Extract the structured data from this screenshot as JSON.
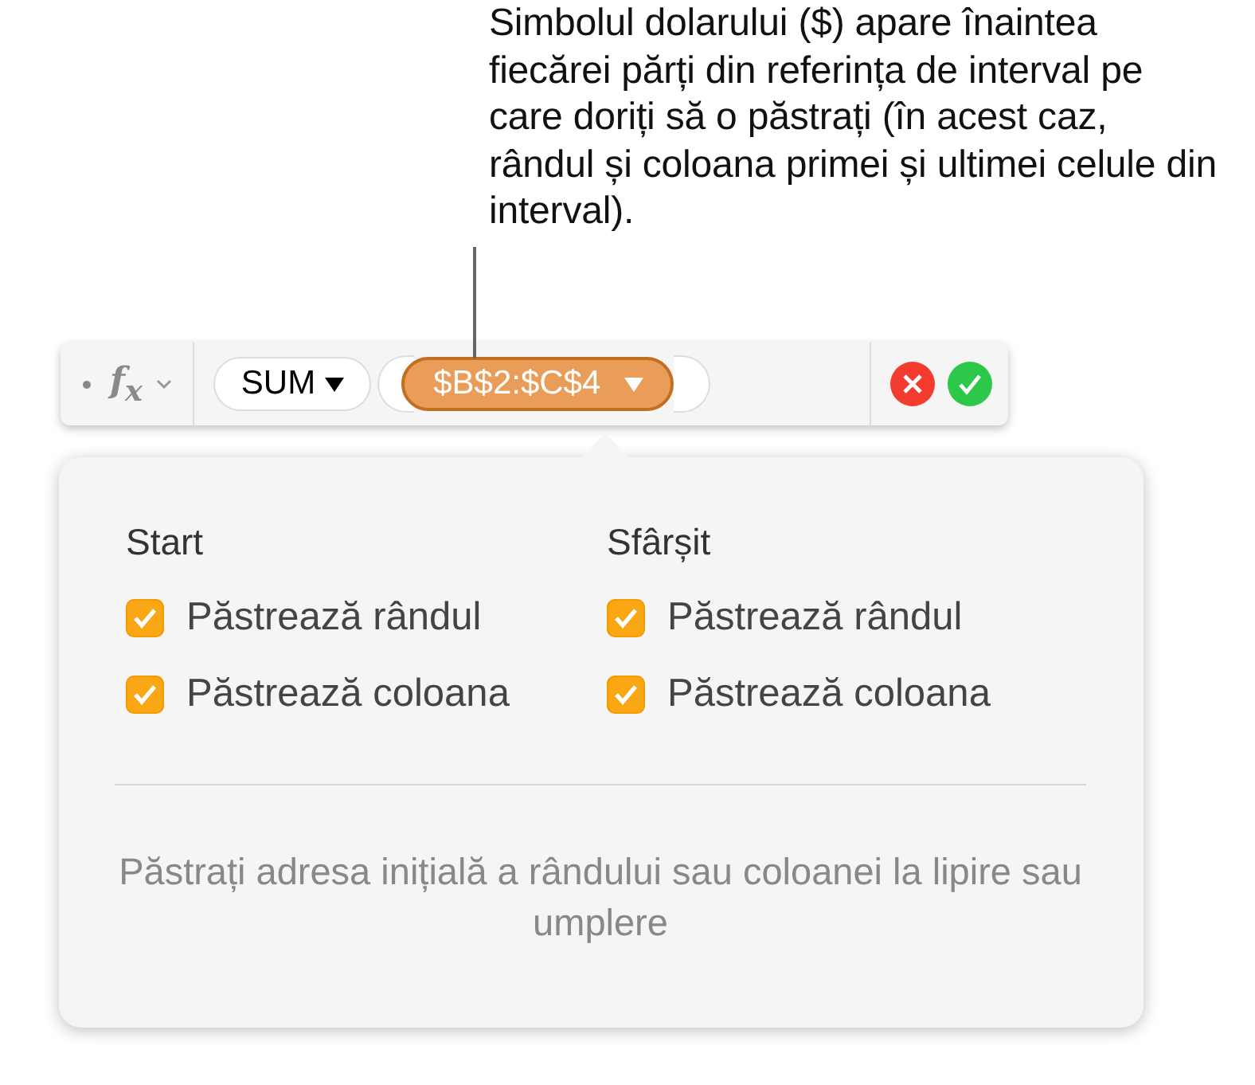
{
  "callout": {
    "text": "Simbolul dolarului ($) apare înaintea fiecărei părți din referința de interval pe care doriți să o păstrați (în acest caz, rândul și coloana primei și ultimei celule din interval)."
  },
  "formula_bar": {
    "fx": "f$_{x}$",
    "function": "SUM",
    "reference": "$B$2:$C$4"
  },
  "popover": {
    "columns": [
      {
        "title": "Start",
        "options": [
          {
            "label": "Păstrează rândul",
            "checked": true
          },
          {
            "label": "Păstrează coloana",
            "checked": true
          }
        ]
      },
      {
        "title": "Sfârșit",
        "options": [
          {
            "label": "Păstrează rândul",
            "checked": true
          },
          {
            "label": "Păstrează coloana",
            "checked": true
          }
        ]
      }
    ],
    "footer": "Păstrați adresa inițială a rândului sau coloanei la lipire sau umplere"
  }
}
